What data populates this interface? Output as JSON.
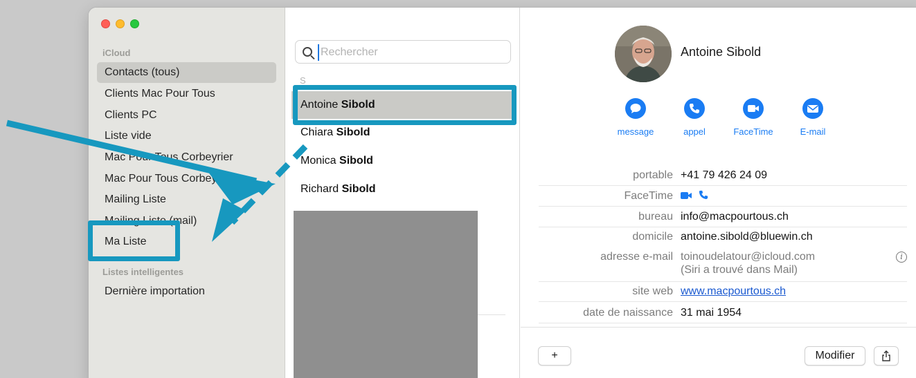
{
  "sidebar": {
    "section_icloud": "iCloud",
    "items": [
      {
        "label": "Contacts (tous)"
      },
      {
        "label": "Clients Mac Pour Tous"
      },
      {
        "label": "Clients PC"
      },
      {
        "label": "Liste vide"
      },
      {
        "label": "Mac Pour Tous Corbeyrier"
      },
      {
        "label": "Mac Pour Tous Corbeyrier"
      },
      {
        "label": "Mailing Liste"
      },
      {
        "label": "Mailing Liste (mail)"
      },
      {
        "label": "Ma Liste"
      }
    ],
    "section_smart": "Listes intelligentes",
    "smart_items": [
      {
        "label": "Dernière importation"
      }
    ]
  },
  "search": {
    "placeholder": "Rechercher"
  },
  "list": {
    "letter": "S",
    "contacts": [
      {
        "first": "Antoine",
        "last": "Sibold"
      },
      {
        "first": "Chiara",
        "last": "Sibold"
      },
      {
        "first": "Monica",
        "last": "Sibold"
      },
      {
        "first": "Richard",
        "last": "Sibold"
      }
    ]
  },
  "detail": {
    "name": "Antoine Sibold",
    "actions": [
      {
        "label": "message",
        "icon": "message-bubble-icon"
      },
      {
        "label": "appel",
        "icon": "phone-icon"
      },
      {
        "label": "FaceTime",
        "icon": "video-camera-icon"
      },
      {
        "label": "E-mail",
        "icon": "envelope-icon"
      }
    ],
    "fields": {
      "mobile": {
        "key": "portable",
        "value": "+41 79 426 24 09"
      },
      "facetime": {
        "key": "FaceTime"
      },
      "work": {
        "key": "bureau",
        "value": "info@macpourtous.ch"
      },
      "home": {
        "key": "domicile",
        "value": "antoine.sibold@bluewin.ch"
      },
      "email": {
        "key": "adresse e-mail",
        "value": "toinoudelatour@icloud.com",
        "sub": "(Siri a trouvé dans Mail)"
      },
      "web": {
        "key": "site web",
        "value": "www.macpourtous.ch"
      },
      "birthday": {
        "key": "date de naissance",
        "value": "31 mai 1954"
      }
    },
    "buttons": {
      "add": "+",
      "edit": "Modifier"
    }
  },
  "colors": {
    "accent": "#1a7cf3",
    "annotation": "#1798bf"
  }
}
